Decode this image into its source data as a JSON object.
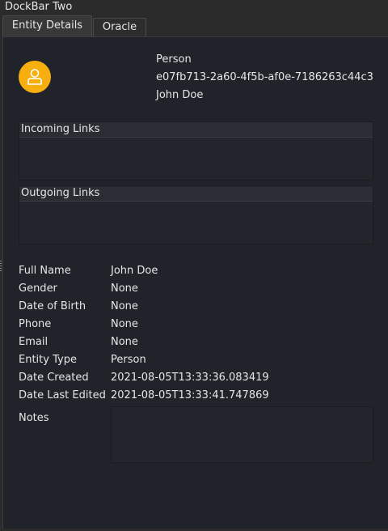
{
  "dock": {
    "title": "DockBar Two"
  },
  "tabs": [
    {
      "label": "Entity Details",
      "active": true
    },
    {
      "label": "Oracle",
      "active": false
    }
  ],
  "entity": {
    "avatar_icon": "person-icon",
    "avatar_color": "#f7ae0f",
    "type_line": "Person",
    "uid_line": "e07fb713-2a60-4f5b-af0e-7186263c44c3",
    "name_line": "John Doe"
  },
  "links": {
    "incoming_title": "Incoming Links",
    "outgoing_title": "Outgoing Links"
  },
  "fields": [
    {
      "label": "Full Name",
      "value": "John Doe"
    },
    {
      "label": "Gender",
      "value": "None"
    },
    {
      "label": "Date of Birth",
      "value": "None"
    },
    {
      "label": "Phone",
      "value": "None"
    },
    {
      "label": "Email",
      "value": "None"
    },
    {
      "label": "Entity Type",
      "value": "Person"
    },
    {
      "label": "Date Created",
      "value": "2021-08-05T13:33:36.083419"
    },
    {
      "label": "Date Last Edited",
      "value": "2021-08-05T13:33:41.747869"
    }
  ],
  "notes": {
    "label": "Notes",
    "value": ""
  }
}
